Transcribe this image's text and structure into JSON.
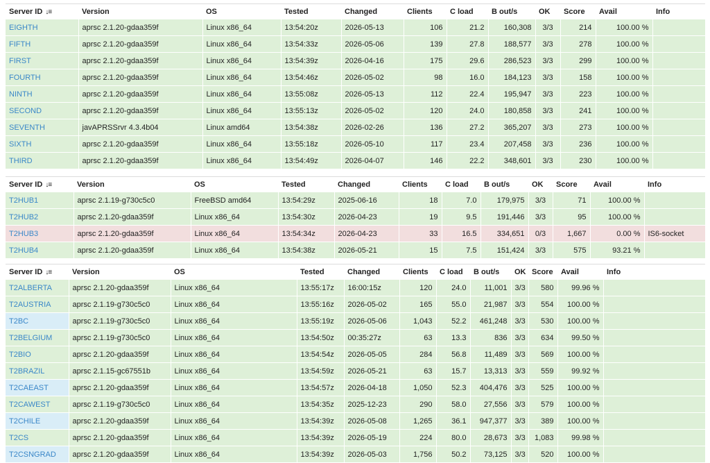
{
  "tables": [
    {
      "headers": [
        "Server ID",
        "Version",
        "OS",
        "Tested",
        "Changed",
        "Clients",
        "C load",
        "B out/s",
        "OK",
        "Score",
        "Avail",
        "Info"
      ],
      "rows": [
        {
          "id": "EIGHTH",
          "version": "aprsc 2.1.20-gdaa359f",
          "os": "Linux x86_64",
          "tested": "13:54:20z",
          "changed": "2026-05-13",
          "clients": "106",
          "cload": "21.2",
          "bout": "160,308",
          "ok": "3/3",
          "score": "214",
          "avail": "100.00 %",
          "info": ""
        },
        {
          "id": "FIFTH",
          "version": "aprsc 2.1.20-gdaa359f",
          "os": "Linux x86_64",
          "tested": "13:54:33z",
          "changed": "2026-05-06",
          "clients": "139",
          "cload": "27.8",
          "bout": "188,577",
          "ok": "3/3",
          "score": "278",
          "avail": "100.00 %",
          "info": ""
        },
        {
          "id": "FIRST",
          "version": "aprsc 2.1.20-gdaa359f",
          "os": "Linux x86_64",
          "tested": "13:54:39z",
          "changed": "2026-04-16",
          "clients": "175",
          "cload": "29.6",
          "bout": "286,523",
          "ok": "3/3",
          "score": "299",
          "avail": "100.00 %",
          "info": ""
        },
        {
          "id": "FOURTH",
          "version": "aprsc 2.1.20-gdaa359f",
          "os": "Linux x86_64",
          "tested": "13:54:46z",
          "changed": "2026-05-02",
          "clients": "98",
          "cload": "16.0",
          "bout": "184,123",
          "ok": "3/3",
          "score": "158",
          "avail": "100.00 %",
          "info": ""
        },
        {
          "id": "NINTH",
          "version": "aprsc 2.1.20-gdaa359f",
          "os": "Linux x86_64",
          "tested": "13:55:08z",
          "changed": "2026-05-13",
          "clients": "112",
          "cload": "22.4",
          "bout": "195,947",
          "ok": "3/3",
          "score": "223",
          "avail": "100.00 %",
          "info": ""
        },
        {
          "id": "SECOND",
          "version": "aprsc 2.1.20-gdaa359f",
          "os": "Linux x86_64",
          "tested": "13:55:13z",
          "changed": "2026-05-02",
          "clients": "120",
          "cload": "24.0",
          "bout": "180,858",
          "ok": "3/3",
          "score": "241",
          "avail": "100.00 %",
          "info": ""
        },
        {
          "id": "SEVENTH",
          "version": "javAPRSSrvr 4.3.4b04",
          "os": "Linux amd64",
          "tested": "13:54:38z",
          "changed": "2026-02-26",
          "clients": "136",
          "cload": "27.2",
          "bout": "365,207",
          "ok": "3/3",
          "score": "273",
          "avail": "100.00 %",
          "info": ""
        },
        {
          "id": "SIXTH",
          "version": "aprsc 2.1.20-gdaa359f",
          "os": "Linux x86_64",
          "tested": "13:55:18z",
          "changed": "2026-05-10",
          "clients": "117",
          "cload": "23.4",
          "bout": "207,458",
          "ok": "3/3",
          "score": "236",
          "avail": "100.00 %",
          "info": ""
        },
        {
          "id": "THIRD",
          "version": "aprsc 2.1.20-gdaa359f",
          "os": "Linux x86_64",
          "tested": "13:54:49z",
          "changed": "2026-04-07",
          "clients": "146",
          "cload": "22.2",
          "bout": "348,601",
          "ok": "3/3",
          "score": "230",
          "avail": "100.00 %",
          "info": ""
        }
      ]
    },
    {
      "headers": [
        "Server ID",
        "Version",
        "OS",
        "Tested",
        "Changed",
        "Clients",
        "C load",
        "B out/s",
        "OK",
        "Score",
        "Avail",
        "Info"
      ],
      "rows": [
        {
          "id": "T2HUB1",
          "version": "aprsc 2.1.19-g730c5c0",
          "os": "FreeBSD amd64",
          "tested": "13:54:29z",
          "changed": "2025-06-16",
          "clients": "18",
          "cload": "7.0",
          "bout": "179,975",
          "ok": "3/3",
          "score": "71",
          "avail": "100.00 %",
          "info": ""
        },
        {
          "id": "T2HUB2",
          "version": "aprsc 2.1.20-gdaa359f",
          "os": "Linux x86_64",
          "tested": "13:54:30z",
          "changed": "2026-04-23",
          "clients": "19",
          "cload": "9.5",
          "bout": "191,446",
          "ok": "3/3",
          "score": "95",
          "avail": "100.00 %",
          "info": ""
        },
        {
          "id": "T2HUB3",
          "version": "aprsc 2.1.20-gdaa359f",
          "os": "Linux x86_64",
          "tested": "13:54:34z",
          "changed": "2026-04-23",
          "clients": "33",
          "cload": "16.5",
          "bout": "334,651",
          "ok": "0/3",
          "score": "1,667",
          "avail": "0.00 %",
          "info": "IS6-socket",
          "bad": true
        },
        {
          "id": "T2HUB4",
          "version": "aprsc 2.1.20-gdaa359f",
          "os": "Linux x86_64",
          "tested": "13:54:38z",
          "changed": "2026-05-21",
          "clients": "15",
          "cload": "7.5",
          "bout": "151,424",
          "ok": "3/3",
          "score": "575",
          "avail": "93.21 %",
          "info": ""
        }
      ]
    },
    {
      "headers": [
        "Server ID",
        "Version",
        "OS",
        "Tested",
        "Changed",
        "Clients",
        "C load",
        "B out/s",
        "OK",
        "Score",
        "Avail",
        "Info"
      ],
      "rows": [
        {
          "id": "T2ALBERTA",
          "version": "aprsc 2.1.20-gdaa359f",
          "os": "Linux x86_64",
          "tested": "13:55:17z",
          "changed": "16:00:15z",
          "clients": "120",
          "cload": "24.0",
          "bout": "11,001",
          "ok": "3/3",
          "score": "580",
          "avail": "99.96 %",
          "info": ""
        },
        {
          "id": "T2AUSTRIA",
          "version": "aprsc 2.1.19-g730c5c0",
          "os": "Linux x86_64",
          "tested": "13:55:16z",
          "changed": "2026-05-02",
          "clients": "165",
          "cload": "55.0",
          "bout": "21,987",
          "ok": "3/3",
          "score": "554",
          "avail": "100.00 %",
          "info": ""
        },
        {
          "id": "T2BC",
          "version": "aprsc 2.1.19-g730c5c0",
          "os": "Linux x86_64",
          "tested": "13:55:19z",
          "changed": "2026-05-06",
          "clients": "1,043",
          "cload": "52.2",
          "bout": "461,248",
          "ok": "3/3",
          "score": "530",
          "avail": "100.00 %",
          "info": "",
          "hl": true
        },
        {
          "id": "T2BELGIUM",
          "version": "aprsc 2.1.19-g730c5c0",
          "os": "Linux x86_64",
          "tested": "13:54:50z",
          "changed": "00:35:27z",
          "clients": "63",
          "cload": "13.3",
          "bout": "836",
          "ok": "3/3",
          "score": "634",
          "avail": "99.50 %",
          "info": ""
        },
        {
          "id": "T2BIO",
          "version": "aprsc 2.1.20-gdaa359f",
          "os": "Linux x86_64",
          "tested": "13:54:54z",
          "changed": "2026-05-05",
          "clients": "284",
          "cload": "56.8",
          "bout": "11,489",
          "ok": "3/3",
          "score": "569",
          "avail": "100.00 %",
          "info": ""
        },
        {
          "id": "T2BRAZIL",
          "version": "aprsc 2.1.15-gc67551b",
          "os": "Linux x86_64",
          "tested": "13:54:59z",
          "changed": "2026-05-21",
          "clients": "63",
          "cload": "15.7",
          "bout": "13,313",
          "ok": "3/3",
          "score": "559",
          "avail": "99.92 %",
          "info": ""
        },
        {
          "id": "T2CAEAST",
          "version": "aprsc 2.1.20-gdaa359f",
          "os": "Linux x86_64",
          "tested": "13:54:57z",
          "changed": "2026-04-18",
          "clients": "1,050",
          "cload": "52.3",
          "bout": "404,476",
          "ok": "3/3",
          "score": "525",
          "avail": "100.00 %",
          "info": "",
          "hl": true
        },
        {
          "id": "T2CAWEST",
          "version": "aprsc 2.1.19-g730c5c0",
          "os": "Linux x86_64",
          "tested": "13:54:35z",
          "changed": "2025-12-23",
          "clients": "290",
          "cload": "58.0",
          "bout": "27,556",
          "ok": "3/3",
          "score": "579",
          "avail": "100.00 %",
          "info": ""
        },
        {
          "id": "T2CHILE",
          "version": "aprsc 2.1.20-gdaa359f",
          "os": "Linux x86_64",
          "tested": "13:54:39z",
          "changed": "2026-05-08",
          "clients": "1,265",
          "cload": "36.1",
          "bout": "947,377",
          "ok": "3/3",
          "score": "389",
          "avail": "100.00 %",
          "info": "",
          "hl": true
        },
        {
          "id": "T2CS",
          "version": "aprsc 2.1.20-gdaa359f",
          "os": "Linux x86_64",
          "tested": "13:54:39z",
          "changed": "2026-05-19",
          "clients": "224",
          "cload": "80.0",
          "bout": "28,673",
          "ok": "3/3",
          "score": "1,083",
          "avail": "99.98 %",
          "info": ""
        },
        {
          "id": "T2CSNGRAD",
          "version": "aprsc 2.1.20-gdaa359f",
          "os": "Linux x86_64",
          "tested": "13:54:39z",
          "changed": "2026-05-03",
          "clients": "1,756",
          "cload": "50.2",
          "bout": "73,125",
          "ok": "3/3",
          "score": "520",
          "avail": "100.00 %",
          "info": "",
          "hl": true
        }
      ]
    }
  ]
}
